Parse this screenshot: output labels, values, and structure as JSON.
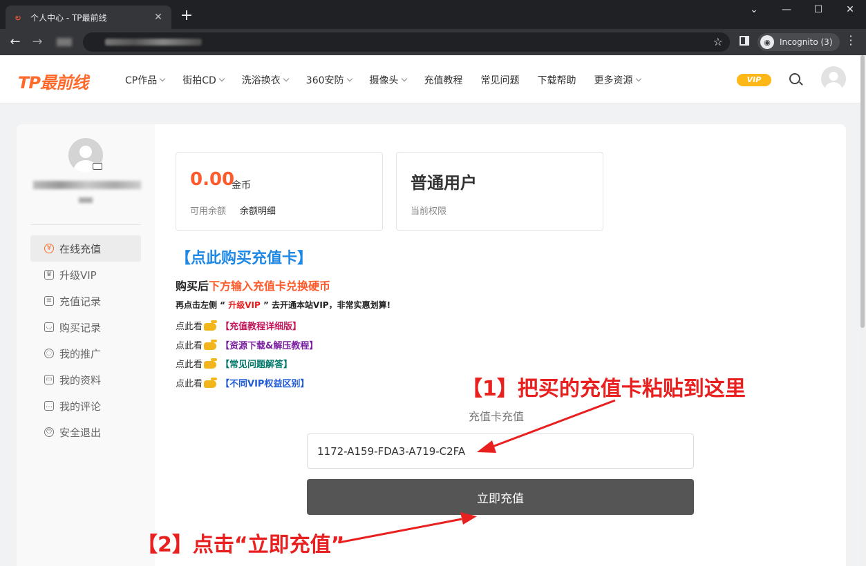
{
  "browser": {
    "tab_title": "个人中心 - TP最前线",
    "tab_close": "✕",
    "new_tab": "+",
    "incognito_label": "Incognito (3)",
    "window_minimize": "—",
    "window_maximize": "☐",
    "window_close": "✕",
    "tab_list": "⌄",
    "back": "←",
    "forward": "→",
    "star": "☆"
  },
  "site": {
    "logo": "TP最前线",
    "nav": [
      {
        "label": "CP作品",
        "dropdown": true
      },
      {
        "label": "街拍CD",
        "dropdown": true
      },
      {
        "label": "洗浴换衣",
        "dropdown": true
      },
      {
        "label": "360安防",
        "dropdown": true
      },
      {
        "label": "摄像头",
        "dropdown": true
      },
      {
        "label": "充值教程",
        "dropdown": false
      },
      {
        "label": "常见问题",
        "dropdown": false
      },
      {
        "label": "下载帮助",
        "dropdown": false
      },
      {
        "label": "更多资源",
        "dropdown": true
      }
    ],
    "vip_badge": "VIP"
  },
  "sidebar": {
    "items": [
      {
        "label": "在线充值",
        "icon": "yen-icon",
        "glyph": "¥",
        "active": true
      },
      {
        "label": "升级VIP",
        "icon": "crown-icon",
        "glyph": "♛",
        "active": false
      },
      {
        "label": "充值记录",
        "icon": "wallet-icon",
        "glyph": "≡",
        "active": false
      },
      {
        "label": "购买记录",
        "icon": "bag-icon",
        "glyph": "◡",
        "active": false
      },
      {
        "label": "我的推广",
        "icon": "share-icon",
        "glyph": "◌",
        "active": false
      },
      {
        "label": "我的资料",
        "icon": "id-card-icon",
        "glyph": "▭",
        "active": false
      },
      {
        "label": "我的评论",
        "icon": "comment-icon",
        "glyph": "…",
        "active": false
      },
      {
        "label": "安全退出",
        "icon": "power-icon",
        "glyph": "⏻",
        "active": false
      }
    ]
  },
  "balance": {
    "value": "0.00",
    "unit": "金币",
    "label": "可用余额",
    "detail_link": "余额明细"
  },
  "permission": {
    "title": "普通用户",
    "label": "当前权限"
  },
  "promo": {
    "buy_link": "【点此购买充值卡】",
    "line1_prefix": "购买后",
    "line1_highlight": "下方输入充值卡兑换硬币",
    "line2_prefix": "再点击左侧 “ ",
    "line2_highlight": "升级VIP",
    "line2_suffix": " ” 去开通本站VIP，非常实惠划算!",
    "see_prefix": "点此看",
    "links": [
      {
        "label": "【充值教程详细版】",
        "color": "#c2185b"
      },
      {
        "label": "【资源下载&解压教程】",
        "color": "#7b1fa2"
      },
      {
        "label": "【常见问题解答】",
        "color": "#00796b"
      },
      {
        "label": "【不同VIP权益区别】",
        "color": "#1e5ad8"
      }
    ]
  },
  "recharge": {
    "label": "充值卡充值",
    "card_code": "1172-A159-FDA3-A719-C2FA",
    "button": "立即充值"
  },
  "annotations": {
    "step1": "【1】把买的充值卡粘贴到这里",
    "step2": "【2】点击“立即充值”"
  }
}
